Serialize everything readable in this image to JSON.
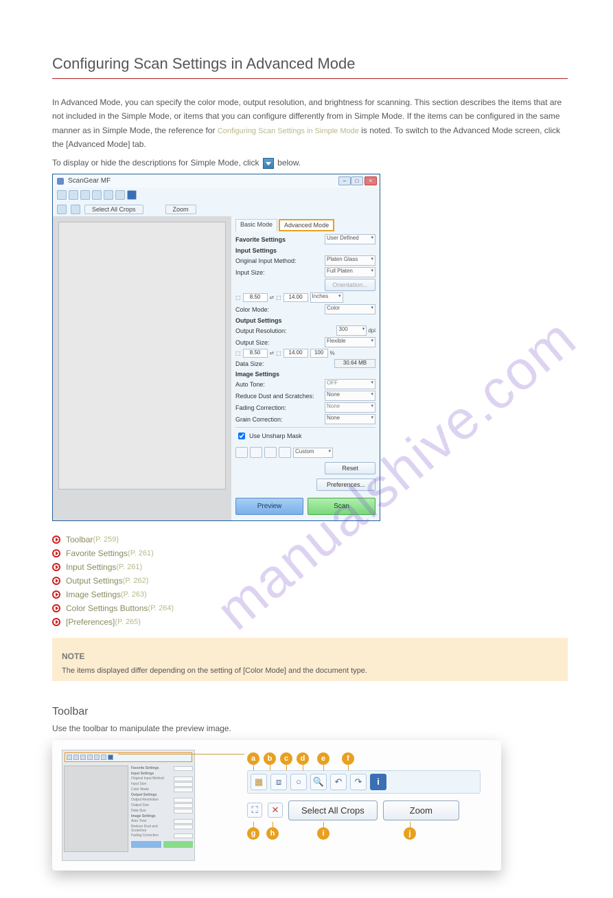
{
  "section": {
    "title": "Configuring Scan Settings in Advanced Mode",
    "lead_prefix": "In Advanced Mode, you can specify the color mode, output resolution, and brightness for scanning. This section describes the items that are not included in the Simple Mode, or items that you can configure differently from in Simple Mode. If the items can be configured in the same manner as in Simple Mode, the reference for ",
    "lead_link": "Configuring Scan Settings in Simple Mode",
    "lead_suffix": " is noted. To switch to the Advanced Mode screen, click the [Advanced Mode] tab.",
    "lead_note_prefix": "To display or hide the descriptions for Simple Mode, click ",
    "lead_note_suffix": " below."
  },
  "screenshot": {
    "window_title": "ScanGear MF",
    "toolbar2": {
      "select_all": "Select All Crops",
      "zoom": "Zoom"
    },
    "tabs": {
      "basic": "Basic Mode",
      "advanced": "Advanced Mode"
    },
    "favorite": {
      "label": "Favorite Settings",
      "value": "User Defined"
    },
    "input": {
      "header": "Input Settings",
      "method_label": "Original Input Method:",
      "method_value": "Platen Glass",
      "size_label": "Input Size:",
      "size_value": "Full Platen",
      "orientation": "Orientation...",
      "w": "8.50",
      "h": "14.00",
      "unit": "Inches",
      "color_label": "Color Mode:",
      "color_value": "Color"
    },
    "output": {
      "header": "Output Settings",
      "res_label": "Output Resolution:",
      "res_value": "300",
      "res_unit": "dpi",
      "size_label": "Output Size:",
      "size_value": "Flexible",
      "w": "8.50",
      "h": "14.00",
      "pct": "100",
      "data_label": "Data Size:",
      "data_value": "30.64 MB"
    },
    "image": {
      "header": "Image Settings",
      "autotone_label": "Auto Tone:",
      "autotone_value": "OFF",
      "dust_label": "Reduce Dust and Scratches:",
      "dust_value": "None",
      "fading_label": "Fading Correction:",
      "fading_value": "None",
      "grain_label": "Grain Correction:",
      "grain_value": "None",
      "unsharp": "Use Unsharp Mask",
      "custom": "Custom",
      "reset": "Reset",
      "prefs": "Preferences..."
    },
    "buttons": {
      "preview": "Preview",
      "scan": "Scan"
    }
  },
  "links": {
    "toolbar": {
      "text": "Toolbar",
      "ref": "(P. 259)"
    },
    "favorite": {
      "text": "Favorite Settings",
      "ref": "(P. 261)"
    },
    "input": {
      "text": "Input Settings",
      "ref": "(P. 261)"
    },
    "output": {
      "text": "Output Settings",
      "ref": "(P. 262)"
    },
    "image": {
      "text": "Image Settings",
      "ref": "(P. 263)"
    },
    "color": {
      "text": "Color Settings Buttons",
      "ref": "(P. 264)"
    },
    "prefs": {
      "text": "[Preferences]",
      "ref": "(P. 265)"
    }
  },
  "note": {
    "title": "NOTE",
    "body": "The items displayed differ depending on the setting of [Color Mode] and the document type."
  },
  "sub": {
    "title": "Toolbar",
    "body": "Use the toolbar to manipulate the preview image."
  },
  "callout": {
    "badges_top": {
      "a": "a",
      "b": "b",
      "c": "c",
      "d": "d",
      "e": "e",
      "f": "f"
    },
    "badges_bottom": {
      "g": "g",
      "h": "h",
      "i": "i",
      "j": "j"
    },
    "select_all": "Select All Crops",
    "zoom": "Zoom"
  },
  "watermark": "manualshive.com"
}
